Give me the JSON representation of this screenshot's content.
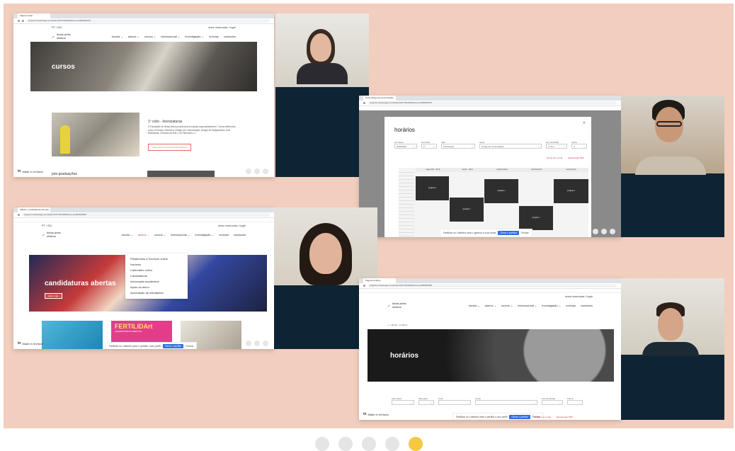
{
  "shot1": {
    "tab": "Página Inicial",
    "url": "projects.invisionapp.com/share/SCPTDNMH8/screens/385490700",
    "topline_left": "PT / EN",
    "topline_right": "área reservada / login",
    "logo": "belas-artes\nulisboa",
    "nav": [
      "escola ⌄",
      "alunos ⌄",
      "cursos ⌄",
      "internacional ⌄",
      "investigação ⌄",
      "notícias",
      "contactos"
    ],
    "hero_title": "cursos",
    "breadcrumb": "⌂ > cursos",
    "section_title": "1º ciclo - licenciaturas",
    "section_text": "A Faculdade de Belas-Artes proporciona formação especializada em 7 áreas diferentes, como a Pintura, Escultura, Design de Comunicação, Design de Equipamento, Arte Multimédia, Ciências da Arte e do Património, e",
    "section_button": "mais sobre os cursos de licenciatura",
    "next_section": "pós-graduações",
    "invision": "Made in InVision"
  },
  "shot2": {
    "tab": "Nova design-de-comunicação",
    "url": "projects.invisionapp.com/share/SCPTDNMH8/screens/388496753",
    "title": "horários",
    "filters": [
      {
        "label": "ano letivo",
        "value": "2020/2021"
      },
      {
        "label": "semestre",
        "value": "1º"
      },
      {
        "label": "ciclo",
        "value": "licenciatura"
      },
      {
        "label": "curso",
        "value": "design de comunicação"
      },
      {
        "label": "ano curricular",
        "value": "1º ano"
      },
      {
        "label": "turma",
        "value": "A"
      }
    ],
    "send_email": "enviar por e-mail",
    "download_pdf": "descarregar PDF",
    "days": [
      "segunda - feira",
      "terça - feira",
      "quarta-feira",
      "quinta-feira",
      "sexta-feira"
    ],
    "class_label": "projeto I",
    "class_room": "sala 3.1.5",
    "cookie_text": "Partilhar no LinkedIn esta o ganhou a sua conta",
    "cookie_btn": "Gerar o perfilar",
    "cookie_close": "Fechar"
  },
  "shot3": {
    "tab": "FBAUL | Candidaturas Abertas",
    "url": "projects.invisionapp.com/share/SCPTDNMH8/screens/384530908",
    "topline_left": "PT / EN",
    "topline_right": "área reservada / login",
    "nav": [
      "escola ⌄",
      "alunos ⌄",
      "cursos ⌄",
      "internacional ⌄",
      "investigação ⌄",
      "notícias",
      "contactos"
    ],
    "dropdown": [
      "Plataformas e Serviços online",
      "Horários",
      "Calendário Letivo",
      "Candidaturas",
      "Informação académica",
      "Apoio ao aluno",
      "Associação de estudantes"
    ],
    "hero_title": "candidaturas abertas",
    "hero_button": "saber mais",
    "art_title": "FERTILIDArt",
    "art_sub": "CANDIDATURAS ABERTAS",
    "cookie_text": "Partilhar no LinkedIn para o perfilar o seu perfil",
    "cookie_btn": "Gerar o perfilar",
    "cookie_close": "Fechar",
    "invision": "Made in InVision"
  },
  "shot4": {
    "tab": "Página Horários",
    "url": "projects.invisionapp.com/share/SCPTDNMH8/screens/388492008",
    "topline_right": "área reservada / login",
    "nav": [
      "escola ⌄",
      "alunos ⌄",
      "cursos ⌄",
      "internacional ⌄",
      "investigação ⌄",
      "notícias",
      "contactos"
    ],
    "breadcrumb": "⌂ > alunos > horários",
    "hero_title": "horários",
    "filters": [
      "Ano Letivo",
      "Semestre",
      "Ciclo",
      "Curso",
      "Ano Curricular",
      "Turma"
    ],
    "send_email": "Enviar por e-mail",
    "download_pdf": "Descarregar PDF",
    "cookie_text": "Partilhar no LinkedIn este o perfilar o seu perfil",
    "cookie_btn": "Gerar o perfilar",
    "cookie_close": "Fechar",
    "invision": "Made in InVision"
  },
  "pager": {
    "count": 5,
    "active": 5
  },
  "colors": {
    "background": "#f1cebe",
    "active_dot": "#f5c842",
    "cookie_btn": "#2f6ee0",
    "video_panel": "#0e2434"
  }
}
